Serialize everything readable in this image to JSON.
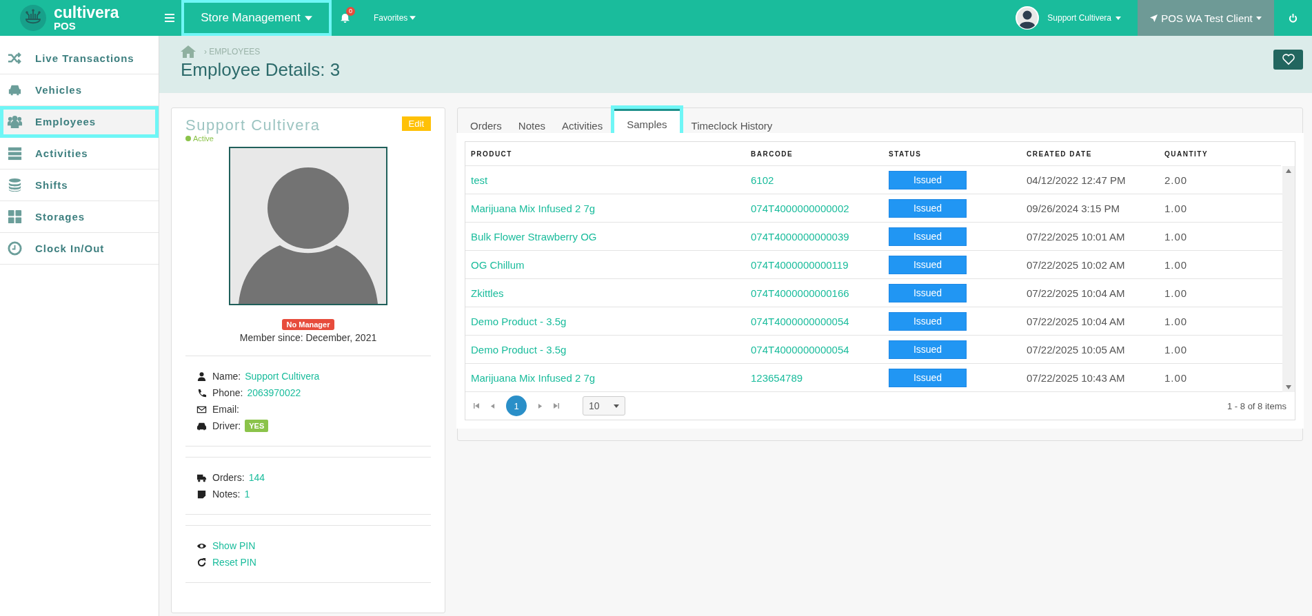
{
  "app": {
    "logo": "cultivera",
    "logo_sub": "POS"
  },
  "topbar": {
    "menu": "Store Management",
    "notifications": "0",
    "favorites": "Favorites",
    "user": "Support Cultivera",
    "client": "POS WA Test Client"
  },
  "sidebar": {
    "items": [
      {
        "label": "Live Transactions",
        "selected": false
      },
      {
        "label": "Vehicles",
        "selected": false
      },
      {
        "label": "Employees",
        "selected": true
      },
      {
        "label": "Activities",
        "selected": false
      },
      {
        "label": "Shifts",
        "selected": false
      },
      {
        "label": "Storages",
        "selected": false
      },
      {
        "label": "Clock In/Out",
        "selected": false
      }
    ]
  },
  "breadcrumb": "› EMPLOYEES",
  "page_title": "Employee Details: 3",
  "profile": {
    "name": "Support Cultivera",
    "status": "Active",
    "edit": "Edit",
    "badge": "No Manager",
    "member_since": "Member since: December, 2021",
    "details": [
      {
        "kind": "link",
        "label": "Name:",
        "value": "Support Cultivera"
      },
      {
        "kind": "link",
        "label": "Phone:",
        "value": "2063970022"
      },
      {
        "kind": "plain",
        "label": "Email:"
      },
      {
        "kind": "badge",
        "label": "Driver:",
        "value": "YES"
      }
    ],
    "counts": [
      {
        "label": "Orders:",
        "value": "144"
      },
      {
        "label": "Notes:",
        "value": "1"
      }
    ],
    "actions": [
      "Show PIN",
      "Reset PIN"
    ]
  },
  "tabs": [
    {
      "label": "Orders",
      "selected": false
    },
    {
      "label": "Notes",
      "selected": false
    },
    {
      "label": "Activities",
      "selected": false
    },
    {
      "label": "Samples",
      "selected": true
    },
    {
      "label": "Timeclock History",
      "selected": false
    }
  ],
  "table": {
    "columns": [
      "PRODUCT",
      "BARCODE",
      "STATUS",
      "CREATED DATE",
      "QUANTITY"
    ],
    "rows": [
      {
        "product": "test",
        "barcode": "6102",
        "status": "Issued",
        "created_date": "04/12/2022 12:47 PM",
        "quantity": "2.00"
      },
      {
        "product": "Marijuana Mix Infused 2 7g",
        "barcode": "074T4000000000002",
        "status": "Issued",
        "created_date": "09/26/2024 3:15 PM",
        "quantity": "1.00"
      },
      {
        "product": "Bulk Flower Strawberry OG",
        "barcode": "074T4000000000039",
        "status": "Issued",
        "created_date": "07/22/2025 10:01 AM",
        "quantity": "1.00"
      },
      {
        "product": "OG Chillum",
        "barcode": "074T4000000000119",
        "status": "Issued",
        "created_date": "07/22/2025 10:02 AM",
        "quantity": "1.00"
      },
      {
        "product": "Zkittles",
        "barcode": "074T4000000000166",
        "status": "Issued",
        "created_date": "07/22/2025 10:04 AM",
        "quantity": "1.00"
      },
      {
        "product": "Demo Product - 3.5g",
        "barcode": "074T4000000000054",
        "status": "Issued",
        "created_date": "07/22/2025 10:04 AM",
        "quantity": "1.00"
      },
      {
        "product": "Demo Product - 3.5g",
        "barcode": "074T4000000000054",
        "status": "Issued",
        "created_date": "07/22/2025 10:05 AM",
        "quantity": "1.00"
      },
      {
        "product": "Marijuana Mix Infused 2 7g",
        "barcode": "123654789",
        "status": "Issued",
        "created_date": "07/22/2025 10:43 AM",
        "quantity": "1.00"
      }
    ]
  },
  "pagination": {
    "pages": [
      {
        "label": "1",
        "selected": true
      }
    ],
    "page_size": "10",
    "summary": "1 - 8 of 8 items"
  }
}
